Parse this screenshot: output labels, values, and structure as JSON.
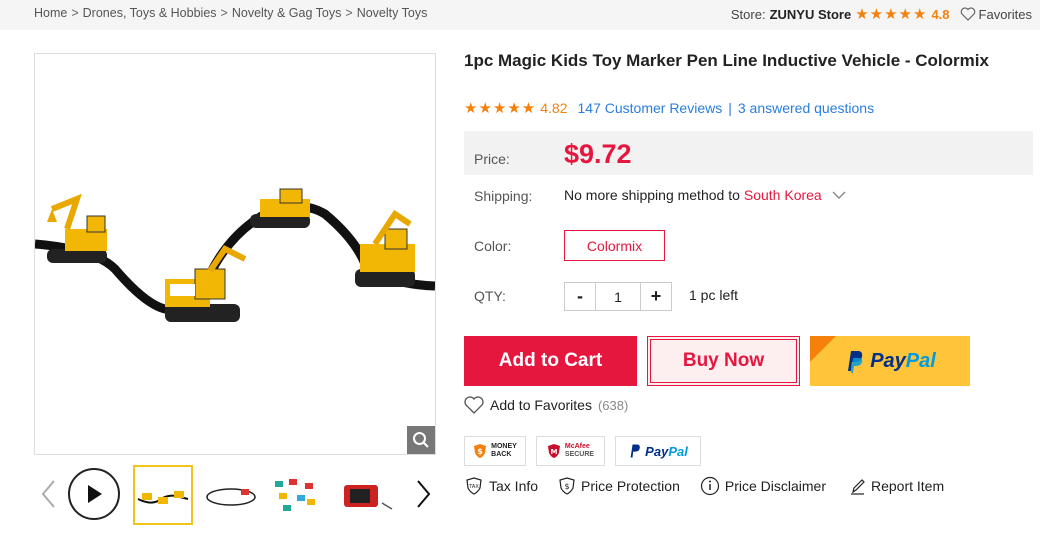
{
  "breadcrumb": [
    "Home",
    "Drones, Toys & Hobbies",
    "Novelty & Gag Toys",
    "Novelty Toys"
  ],
  "store": {
    "prefix": "Store:",
    "name": "ZUNYU Store",
    "rating": "4.8",
    "favorites_label": "Favorites"
  },
  "product": {
    "title": "1pc Magic Kids Toy Marker Pen Line Inductive Vehicle - Colormix",
    "rating": "4.82",
    "reviews": "147 Customer Reviews",
    "separator": "|",
    "questions": "3 answered questions",
    "price_label": "Price:",
    "price": "$9.72",
    "shipping_label": "Shipping:",
    "shipping_text": "No more shipping method to",
    "shipping_country": "South Korea",
    "color_label": "Color:",
    "color_value": "Colormix",
    "qty_label": "QTY:",
    "qty_minus": "-",
    "qty_value": "1",
    "qty_plus": "+",
    "qty_left": "1 pc left"
  },
  "actions": {
    "add_to_cart": "Add to Cart",
    "buy_now": "Buy Now",
    "paypal_a": "Pay",
    "paypal_b": "Pal",
    "add_favorites": "Add to Favorites",
    "favorites_count": "(638)"
  },
  "badges": {
    "money_back_1": "MONEY",
    "money_back_2": "BACK",
    "mcafee_1": "McAfee",
    "mcafee_2": "SECURE",
    "paypal_a": "Pay",
    "paypal_b": "Pal"
  },
  "info": {
    "tax": "Tax Info",
    "price_protection": "Price Protection",
    "price_disclaimer": "Price Disclaimer",
    "report": "Report Item",
    "tax_icon_text": "TAX"
  },
  "colors": {
    "accent": "#e5173f",
    "star": "#f5800c",
    "link": "#2a7ee0",
    "paypal_yellow": "#ffc439"
  }
}
